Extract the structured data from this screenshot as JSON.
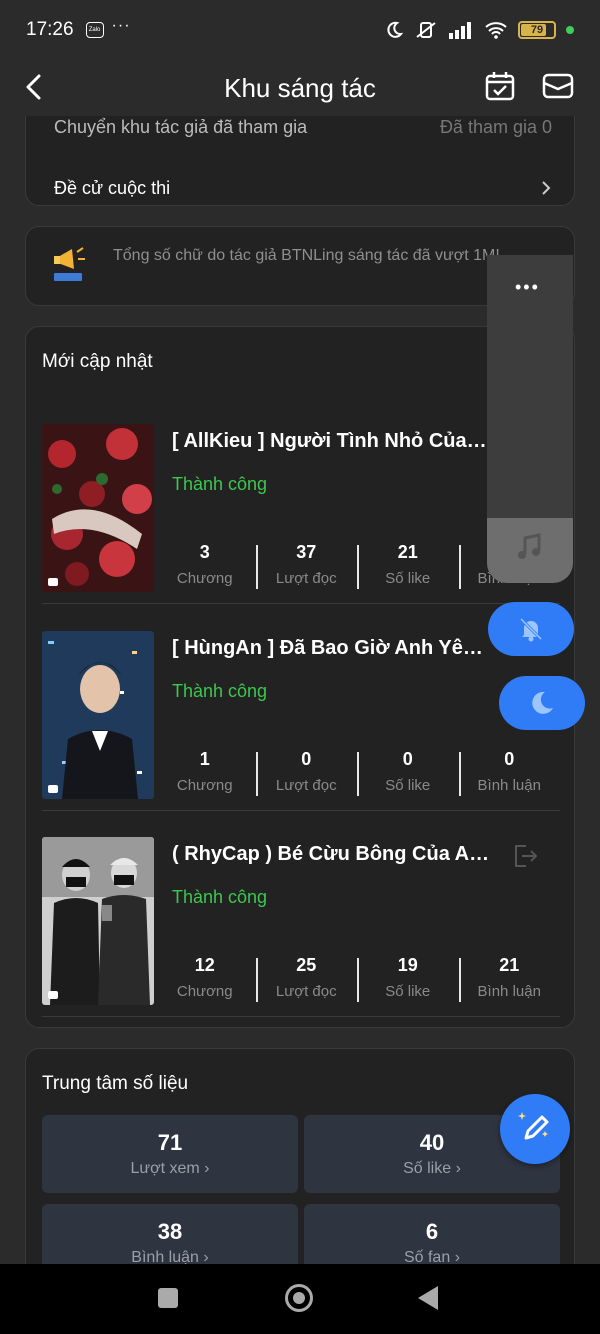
{
  "status_bar": {
    "time": "17:26",
    "app_badge": "Zalo",
    "more": "···",
    "battery": "79",
    "battery_level": 0.79
  },
  "header": {
    "title": "Khu sáng tác",
    "icons": [
      "back-arrow-icon",
      "calendar-check-icon",
      "mail-icon"
    ]
  },
  "menu": {
    "partial_item": "Chuyển khu tác giả đã tham gia",
    "partial_value": "Đã tham gia 0",
    "vote_item": "Đề cử cuộc thi"
  },
  "notice": {
    "text": "Tổng số chữ do tác giả BTNLing sáng tác đã vượt 1M!"
  },
  "recent": {
    "title": "Mới cập nhật",
    "stat_labels": {
      "chapters": "Chương",
      "reads": "Lượt đọc",
      "likes": "Số like",
      "comments": "Bình luận"
    },
    "books": [
      {
        "title": "[ AllKieu ] Người Tình Nhỏ Của Các Anh",
        "status": "Thành công",
        "chapters": "3",
        "reads": "37",
        "likes": "21",
        "comments": ""
      },
      {
        "title": "[ HùngAn ] Đã Bao Giờ Anh Yêu Em Chưa?",
        "status": "Thành công",
        "chapters": "1",
        "reads": "0",
        "likes": "0",
        "comments": "0"
      },
      {
        "title": "( RhyCap ) Bé Cừu Bông Của Anh",
        "status": "Thành công",
        "chapters": "12",
        "reads": "25",
        "likes": "19",
        "comments": "21"
      }
    ]
  },
  "data_center": {
    "title": "Trung tâm số liệu",
    "tiles": [
      {
        "value": "71",
        "label": "Lượt xem"
      },
      {
        "value": "40",
        "label": "Số like"
      },
      {
        "value": "38",
        "label": "Bình luận"
      },
      {
        "value": "6",
        "label": "Số fan"
      }
    ]
  },
  "floating": {
    "more": "•••",
    "icons": [
      "music-note-icon",
      "bell-off-icon",
      "moon-icon",
      "edit-pencil-icon"
    ]
  },
  "colors": {
    "accent": "#2f7cf6",
    "success": "#3ec64e",
    "card": "#222222",
    "background": "#2b2b2b"
  }
}
